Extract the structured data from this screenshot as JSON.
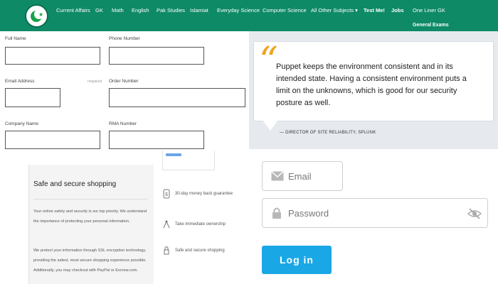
{
  "navbar": {
    "items": [
      {
        "label": "Current Affairs"
      },
      {
        "label": "GK"
      },
      {
        "label": "Math"
      },
      {
        "label": "English"
      },
      {
        "label": "Pak Studies"
      },
      {
        "label": "Islamiat"
      },
      {
        "label": "Everyday Science"
      },
      {
        "label": "Computer Science"
      },
      {
        "label": "All Other Subjects ▾"
      },
      {
        "label": "Test Me!"
      },
      {
        "label": "Jobs"
      },
      {
        "label": "One Liner GK"
      }
    ],
    "sub_item": "General Exams",
    "logo_icon": "crescent-star-icon",
    "color": "#0e8a66"
  },
  "order_form": {
    "full_name_label": "Full Name",
    "phone_label": "Phone Number",
    "email_label": "Email Address",
    "email_hint": "required",
    "order_label": "Order Number",
    "company_label": "Company Name",
    "rma_label": "RMA Number",
    "full_name_value": "",
    "phone_value": "",
    "email_value": "",
    "order_value": "",
    "company_value": "",
    "rma_value": ""
  },
  "quote": {
    "mark": "“",
    "text": "Puppet keeps the environment consistent and in its intended state. Having a consistent environment puts a limit on the unknowns, which is good for our security posture as well.",
    "author": "— DIRECTOR OF SITE RELIABILITY, SPLUNK",
    "accent_color": "#f0a318"
  },
  "safe_shopping": {
    "title": "Safe and secure shopping",
    "paragraph1": "Your online safety and security is our top priority. We understand the importance of protecting your personal information.",
    "paragraph2": "We protect your information through SSL encryption technology, providing the safest, most secure shopping experience possible. Additionally, you may checkout with PayPal or Escrow.com.",
    "features": [
      {
        "icon": "money-back-icon",
        "label": "30-day money back guarantee"
      },
      {
        "icon": "ownership-icon",
        "label": "Take immediate ownership"
      },
      {
        "icon": "secure-shopping-icon",
        "label": "Safe and secure shopping"
      }
    ]
  },
  "login": {
    "email_placeholder": "Email",
    "password_placeholder": "Password",
    "submit_label": "Log in",
    "email_icon": "envelope-icon",
    "password_icon": "lock-icon",
    "toggle_icon": "eye-slash-icon",
    "button_color": "#1aa7e6"
  }
}
